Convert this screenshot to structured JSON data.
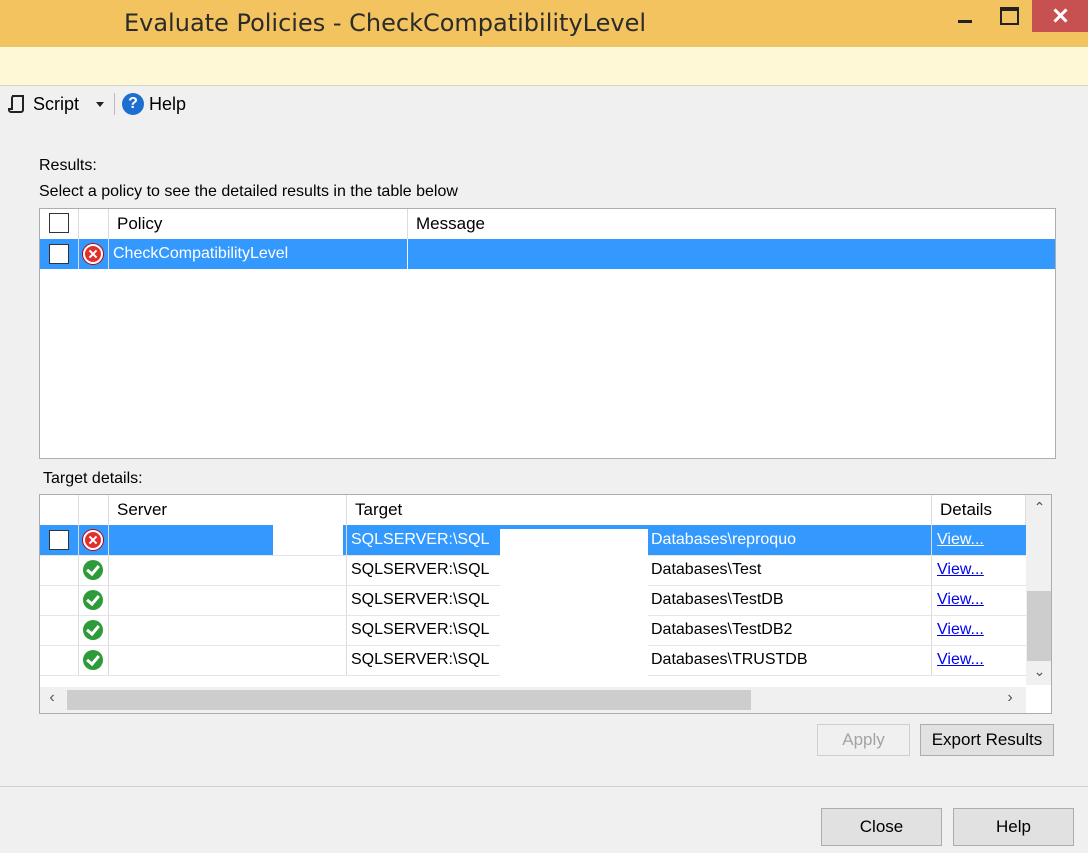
{
  "window": {
    "title": "Evaluate Policies - CheckCompatibilityLevel"
  },
  "toolbar": {
    "script_label": "Script",
    "help_label": "Help"
  },
  "results": {
    "heading": "Results:",
    "instruction": "Select a policy to see the detailed results in the table below",
    "columns": [
      "Policy",
      "Message"
    ],
    "rows": [
      {
        "status": "error",
        "policy": "CheckCompatibilityLevel",
        "message": ""
      }
    ]
  },
  "target_details": {
    "heading": "Target details:",
    "columns": [
      "Server",
      "Target",
      "Details"
    ],
    "rows": [
      {
        "status": "error",
        "server": "",
        "target_prefix": "SQLSERVER:\\SQL",
        "target_suffix": "Databases\\reproquo",
        "details": "View..."
      },
      {
        "status": "ok",
        "server": "",
        "target_prefix": "SQLSERVER:\\SQL",
        "target_suffix": "Databases\\Test",
        "details": "View..."
      },
      {
        "status": "ok",
        "server": "",
        "target_prefix": "SQLSERVER:\\SQL",
        "target_suffix": "Databases\\TestDB",
        "details": "View..."
      },
      {
        "status": "ok",
        "server": "",
        "target_prefix": "SQLSERVER:\\SQL",
        "target_suffix": "Databases\\TestDB2",
        "details": "View..."
      },
      {
        "status": "ok",
        "server": "",
        "target_prefix": "SQLSERVER:\\SQL",
        "target_suffix": "Databases\\TRUSTDB",
        "details": "View..."
      }
    ]
  },
  "buttons": {
    "apply": "Apply",
    "export": "Export Results",
    "close": "Close",
    "help": "Help"
  },
  "colors": {
    "titlebar": "#f2c35e",
    "selection": "#3399ff",
    "close_button": "#c75050"
  },
  "icons": [
    "script-icon",
    "dropdown-arrow-icon",
    "help-icon",
    "error-status-icon",
    "success-status-icon",
    "minimize-icon",
    "maximize-icon",
    "close-icon"
  ]
}
